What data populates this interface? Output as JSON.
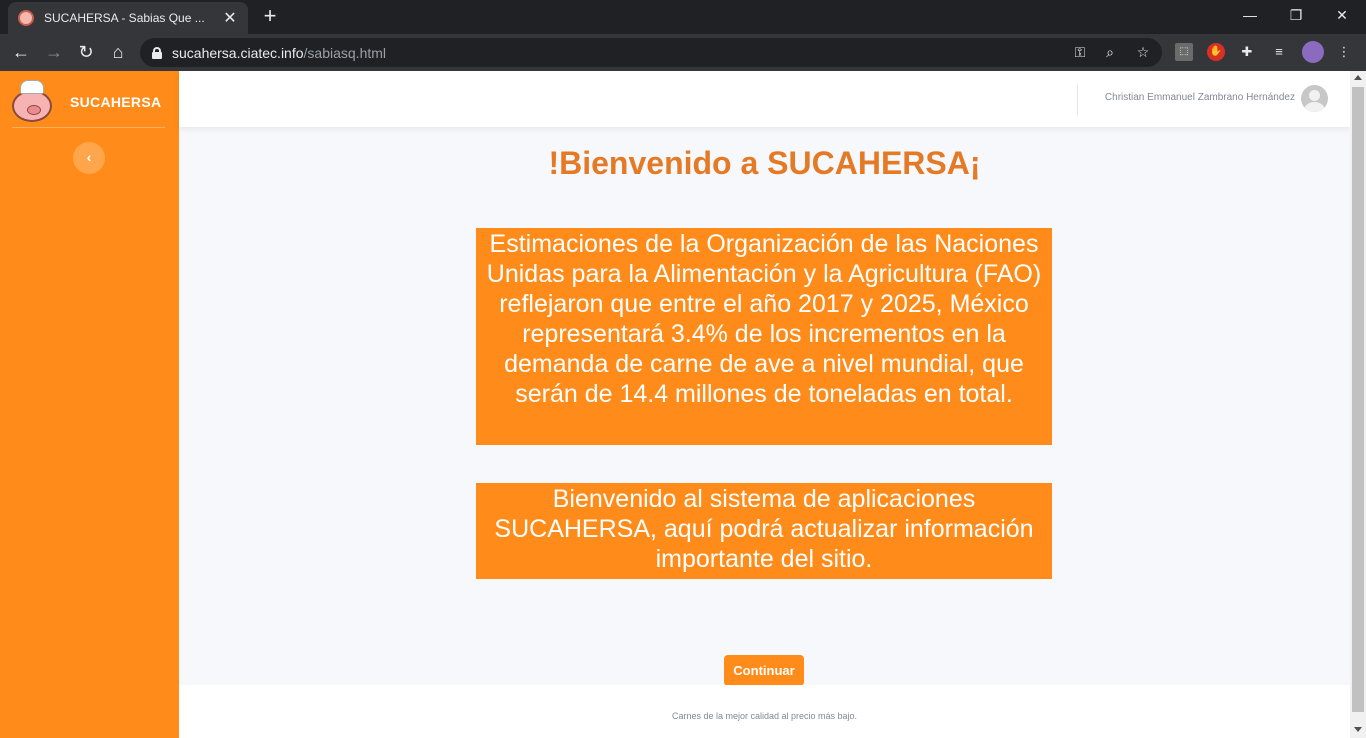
{
  "browser": {
    "tab_title": "SUCAHERSA - Sabias Que ...",
    "url_host": "sucahersa.ciatec.info",
    "url_path": "/sabiasq.html",
    "icons": [
      "back-icon",
      "forward-icon",
      "reload-icon",
      "home-icon",
      "lock-icon",
      "key-icon",
      "zoom-icon",
      "star-icon",
      "pdf-extension-icon",
      "adblock-icon",
      "extensions-icon",
      "media-control-icon",
      "profile-icon",
      "menu-icon"
    ]
  },
  "sidebar": {
    "brand_name": "SUCAHERSA",
    "toggle_glyph": "‹"
  },
  "topbar": {
    "user_name": "Christian Emmanuel Zambrano Hernández"
  },
  "main": {
    "title": "!Bienvenido a SUCAHERSA¡",
    "fao_text": "Estimaciones de la Organización de las Naciones Unidas para la Alimentación y la Agricultura (FAO) reflejaron que entre el año 2017 y 2025, México representará 3.4% de los incrementos en la demanda de carne de ave a nivel mundial, que serán de 14.4 millones de toneladas en total.",
    "welcome_text": "Bienvenido al sistema de aplicaciones SUCAHERSA, aquí podrá actualizar información importante del sitio.",
    "continue_label": "Continuar"
  },
  "footer": {
    "text": "Carnes de la mejor calidad al precio más bajo."
  },
  "colors": {
    "accent": "#ff8c1a",
    "title": "#e47a26"
  }
}
